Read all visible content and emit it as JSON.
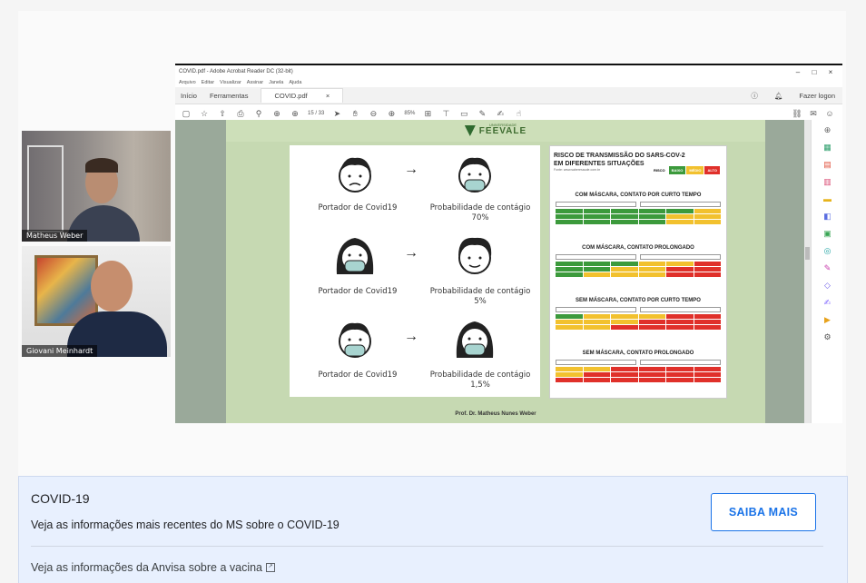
{
  "participants": [
    {
      "name": "Matheus Weber"
    },
    {
      "name": "Giovani Meinhardt"
    }
  ],
  "acrobat": {
    "window_title": "COVID.pdf - Adobe Acrobat Reader DC (32-bit)",
    "window_buttons": [
      "–",
      "□",
      "×"
    ],
    "menu": [
      "Arquivo",
      "Editar",
      "Visualizar",
      "Assinar",
      "Janela",
      "Ajuda"
    ],
    "tabs": {
      "home": "Início",
      "tools": "Ferramentas",
      "doc": "COVID.pdf",
      "close": "×"
    },
    "login": "Fazer logon",
    "page_indicator": "15 / 33",
    "zoom": "85%",
    "toolbar_icons": [
      "save-icon",
      "star-icon",
      "upload-icon",
      "print-icon",
      "search-icon",
      "arrow-up-icon",
      "arrow-down-icon",
      "cursor-icon",
      "hand-icon",
      "zoom-out-icon",
      "zoom-in-icon"
    ]
  },
  "slide": {
    "logo_sup": "UNIVERSIDADE",
    "logo": "FEEVALE",
    "rows": [
      {
        "left_caption": "Portador de Covid19",
        "right_caption_1": "Probabilidade de contágio",
        "right_caption_2": "70%"
      },
      {
        "left_caption": "Portador de Covid19",
        "right_caption_1": "Probabilidade de contágio",
        "right_caption_2": "5%"
      },
      {
        "left_caption": "Portador de Covid19",
        "right_caption_1": "Probabilidade de contágio",
        "right_caption_2": "1,5%"
      }
    ],
    "arrow": "→",
    "risk_title_1": "RISCO DE TRANSMISSÃO DO SARS-COV-2",
    "risk_title_2": "EM DIFERENTES SITUAÇÕES",
    "risk_source": "Fonte: www.saberesaude.com.br",
    "legend": {
      "label": "RISCO",
      "low": "BAIXO",
      "mid": "MÉDIO",
      "high": "ALTO"
    },
    "sections": [
      "COM MÁSCARA, CONTATO POR CURTO TEMPO",
      "COM MÁSCARA, CONTATO PROLONGADO",
      "SEM MÁSCARA, CONTATO POR CURTO TEMPO",
      "SEM MÁSCARA, CONTATO PROLONGADO"
    ],
    "footer": "Prof. Dr. Matheus Nunes Weber",
    "colors": {
      "green": "#3c9a3c",
      "yellow": "#f2c12e",
      "red": "#e0302a"
    }
  },
  "card": {
    "title": "COVID-19",
    "description": "Veja as informações mais recentes do MS sobre o COVID-19",
    "button": "SAIBA MAIS",
    "link": "Veja as informações da Anvisa sobre a vacina",
    "link_icon": "external-link-icon"
  }
}
